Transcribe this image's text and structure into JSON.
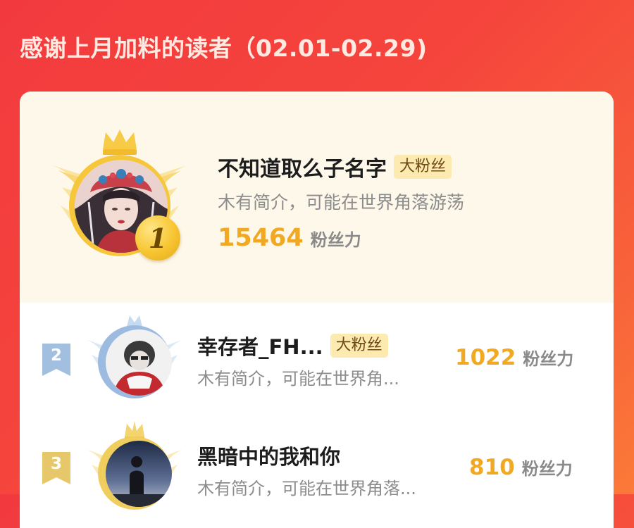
{
  "header": {
    "title": "感谢上月加料的读者（02.01-02.29)"
  },
  "leaderboard": [
    {
      "rank": "1",
      "name": "不知道取么子名字",
      "badge": "大粉丝",
      "bio": "木有简介，可能在世界角落游荡",
      "points": "15464",
      "points_unit": "粉丝力",
      "frame_color": "#f6c63b"
    },
    {
      "rank": "2",
      "name": "幸存者_FH...",
      "badge": "大粉丝",
      "bio": "木有简介，可能在世界角...",
      "points": "1022",
      "points_unit": "粉丝力",
      "frame_color": "#a9c6e8"
    },
    {
      "rank": "3",
      "name": "黑暗中的我和你",
      "bio": "木有简介，可能在世界角落...",
      "points": "810",
      "points_unit": "粉丝力",
      "frame_color": "#f2d36a"
    }
  ],
  "colors": {
    "background": "#f5453c",
    "accent": "#f1a823",
    "badge_bg": "#fdeab0"
  },
  "icons": [
    "crown-icon",
    "wings-icon",
    "rank-medal-icon",
    "rank-ribbon-icon"
  ]
}
